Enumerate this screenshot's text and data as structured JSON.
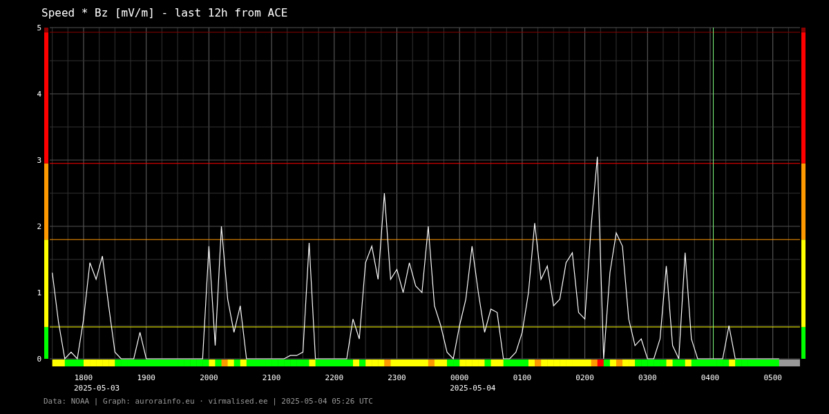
{
  "title": "Speed * Bz [mV/m] - last 12h from ACE",
  "chart": {
    "chart_data": {
      "type": "line",
      "categories": [
        null,
        null,
        null,
        null,
        null,
        "1800",
        null,
        null,
        null,
        null,
        null,
        null,
        null,
        null,
        null,
        "1900",
        null,
        null,
        null,
        null,
        null,
        null,
        null,
        null,
        null,
        "2000",
        null,
        null,
        null,
        null,
        null,
        null,
        null,
        null,
        null,
        "2100",
        null,
        null,
        null,
        null,
        null,
        null,
        null,
        null,
        null,
        "2200",
        null,
        null,
        null,
        null,
        null,
        null,
        null,
        null,
        null,
        "2300",
        null,
        null,
        null,
        null,
        null,
        null,
        null,
        null,
        null,
        "0000",
        null,
        null,
        null,
        null,
        null,
        null,
        null,
        null,
        null,
        "0100",
        null,
        null,
        null,
        null,
        null,
        null,
        null,
        null,
        null,
        "0200",
        null,
        null,
        null,
        null,
        null,
        null,
        null,
        null,
        null,
        "0300",
        null,
        null,
        null,
        null,
        null,
        null,
        null,
        null,
        null,
        "0400",
        null,
        null,
        null,
        null,
        null,
        null,
        null,
        null,
        null,
        "0500",
        null
      ],
      "series": [
        {
          "color": "#ffffff",
          "values": [
            1.3,
            0.55,
            0,
            0.1,
            0,
            0.6,
            1.45,
            1.2,
            1.55,
            0.8,
            0.1,
            0,
            0,
            0,
            0.4,
            0,
            0,
            0,
            0,
            0,
            0,
            0,
            0,
            0,
            0,
            1.7,
            0.2,
            2.0,
            0.9,
            0.4,
            0.8,
            0,
            0,
            0,
            0,
            0,
            0,
            0,
            0.05,
            0.05,
            0.1,
            1.75,
            0,
            0,
            0,
            0,
            0,
            0,
            0.6,
            0.3,
            1.45,
            1.7,
            1.2,
            2.5,
            1.2,
            1.35,
            1.0,
            1.45,
            1.1,
            1.0,
            2.0,
            0.8,
            0.5,
            0.1,
            0,
            0.5,
            0.9,
            1.7,
            1.0,
            0.4,
            0.75,
            0.7,
            0,
            0,
            0.1,
            0.4,
            1.0,
            2.05,
            1.2,
            1.4,
            0.8,
            0.9,
            1.45,
            1.6,
            0.7,
            0.6,
            2.0,
            3.05,
            0,
            1.3,
            1.9,
            1.7,
            0.6,
            0.2,
            0.3,
            0,
            0,
            0.3,
            1.4,
            0.2,
            0,
            1.6,
            0.3,
            0,
            0,
            0,
            0,
            0,
            0.5,
            0,
            0,
            0,
            0,
            0,
            0,
            0,
            0
          ]
        }
      ],
      "ylim": [
        0,
        5
      ],
      "yticks": [
        0,
        1,
        2,
        3,
        4,
        5
      ],
      "grid": true,
      "ref_lines": [
        {
          "axis": "y",
          "value": 0.48,
          "color": "#ffff00"
        },
        {
          "axis": "y",
          "value": 1.8,
          "color": "#ff9900"
        },
        {
          "axis": "y",
          "value": 2.95,
          "color": "#ff0000"
        },
        {
          "axis": "y",
          "value": 4.93,
          "color": "#8b0000"
        }
      ]
    },
    "scale_segments": [
      {
        "color": "#00ff00"
      },
      {
        "color": "#ffff00"
      },
      {
        "color": "#ff9900"
      },
      {
        "color": "#ff0000"
      },
      {
        "color": "#8b0000"
      }
    ],
    "date_labels": [
      "2025-05-03",
      "2025-05-04"
    ]
  },
  "footer": "Data: NOAA | Graph: aurorainfo.eu · virmalised.ee | 2025-05-04 05:26 UTC"
}
